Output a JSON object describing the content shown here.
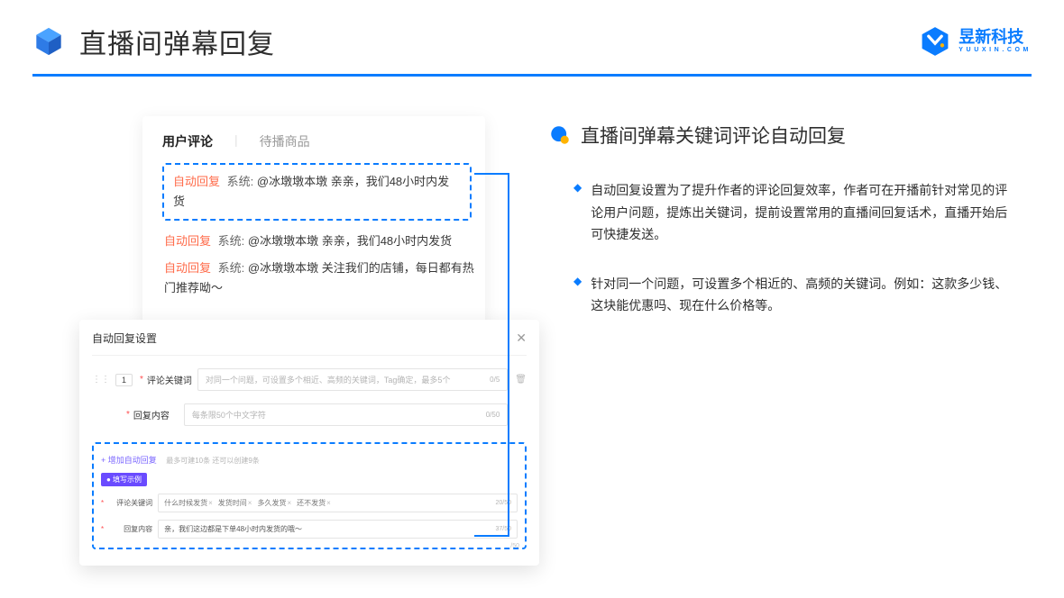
{
  "header": {
    "title": "直播间弹幕回复",
    "logo_cn": "昱新科技",
    "logo_en": "YUUXIN.COM"
  },
  "comments": {
    "tab_active": "用户评论",
    "tab_other": "待播商品",
    "reply_tag": "自动回复",
    "sys_label": "系统:",
    "highlight_msg": "@冰墩墩本墩 亲亲，我们48小时内发货",
    "line2": "@冰墩墩本墩 亲亲，我们48小时内发货",
    "line3": "@冰墩墩本墩 关注我们的店铺，每日都有热门推荐呦～"
  },
  "modal": {
    "title": "自动回复设置",
    "badge": "1",
    "kw_label": "评论关键词",
    "kw_placeholder": "对同一个问题，可设置多个相近、高频的关键词，Tag确定，最多5个",
    "kw_count": "0/5",
    "content_label": "回复内容",
    "content_placeholder": "每条限50个中文字符",
    "content_count": "0/50",
    "add_link": "+ 增加自动回复",
    "add_note": "最多可建10条 还可以创建9条",
    "example_tag": "● 填写示例",
    "ex_kw_label": "评论关键词",
    "ex_chips": [
      "什么时候发货",
      "发货时间",
      "多久发货",
      "还不发货"
    ],
    "ex_kw_count": "20/50",
    "ex_content_label": "回复内容",
    "ex_content_value": "亲，我们这边都是下单48小时内发货的哦～",
    "ex_content_count": "37/50",
    "stray_count": "/50"
  },
  "right": {
    "title": "直播间弹幕关键词评论自动回复",
    "p1": "自动回复设置为了提升作者的评论回复效率，作者可在开播前针对常见的评论用户问题，提炼出关键词，提前设置常用的直播间回复话术，直播开始后可快捷发送。",
    "p2": "针对同一个问题，可设置多个相近的、高频的关键词。例如：这款多少钱、这块能优惠吗、现在什么价格等。"
  }
}
